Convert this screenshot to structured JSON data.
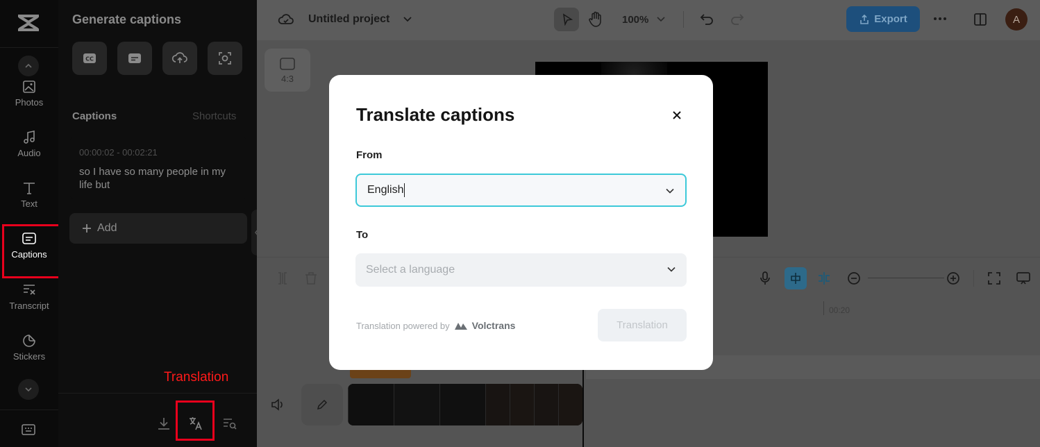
{
  "rail": {
    "items": [
      {
        "label": "Photos",
        "icon": "image-icon"
      },
      {
        "label": "Audio",
        "icon": "music-note-icon"
      },
      {
        "label": "Text",
        "icon": "text-t-icon"
      },
      {
        "label": "Captions",
        "icon": "captions-icon",
        "active": true
      },
      {
        "label": "Transcript",
        "icon": "transcript-icon"
      },
      {
        "label": "Stickers",
        "icon": "sticker-icon"
      }
    ]
  },
  "panel": {
    "title": "Generate captions",
    "tabs": {
      "captions": "Captions",
      "shortcuts": "Shortcuts"
    },
    "caption": {
      "time": "00:00:02 - 00:02:21",
      "text": "so I have so many people in my life but"
    },
    "add_label": "Add",
    "annotation": "Translation"
  },
  "topbar": {
    "project_title": "Untitled project",
    "zoom": "100%",
    "export_label": "Export",
    "avatar_initial": "A"
  },
  "canvas": {
    "ratio_label": "4:3"
  },
  "timeline": {
    "ruler_label": "00:20"
  },
  "modal": {
    "title": "Translate captions",
    "from_label": "From",
    "from_value": "English",
    "to_label": "To",
    "to_placeholder": "Select a language",
    "powered_by": "Translation powered by",
    "brand": "Volctrans",
    "translate_button": "Translation"
  },
  "colors": {
    "accent_cyan": "#3cc9d9",
    "annotation_red": "#e8001c",
    "export_blue": "#1d4f7c"
  }
}
